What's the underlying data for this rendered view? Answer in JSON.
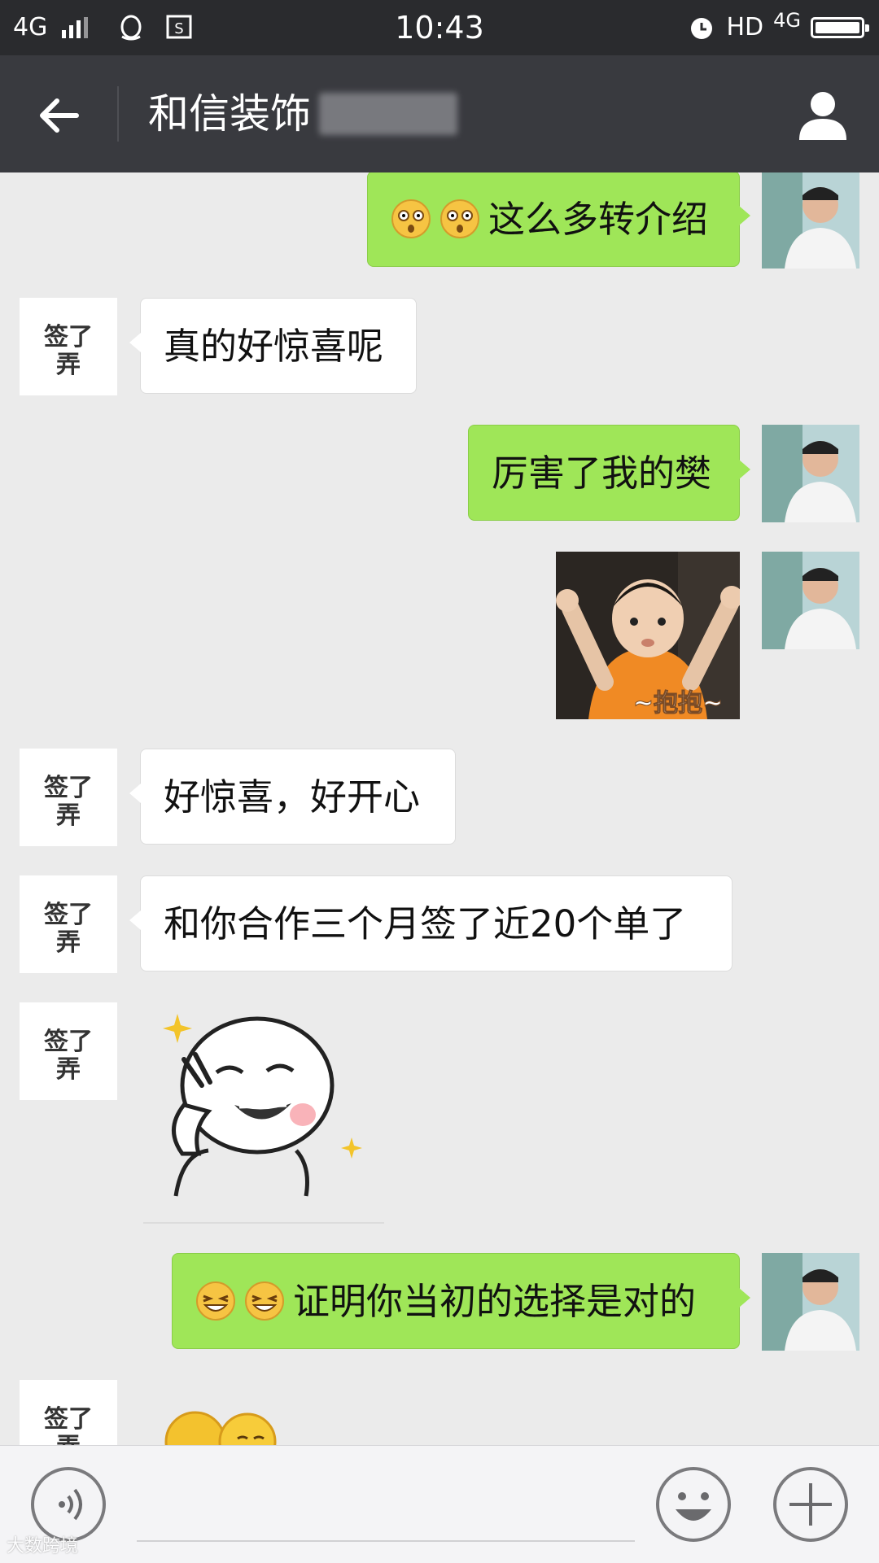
{
  "status_bar": {
    "network_left": "4G",
    "time": "10:43",
    "hd": "HD",
    "network_right": "4G"
  },
  "nav": {
    "title": "和信装饰",
    "back_icon": "arrow-left-icon",
    "profile_icon": "person-icon"
  },
  "messages": [
    {
      "sender": "me",
      "text": "这么多转介绍",
      "emoji": [
        "surprised-emoji",
        "surprised-emoji"
      ]
    },
    {
      "sender": "them",
      "text": "真的好惊喜呢"
    },
    {
      "sender": "me",
      "text": "厉害了我的樊"
    },
    {
      "sender": "me",
      "type": "sticker",
      "caption": "~抱抱~"
    },
    {
      "sender": "them",
      "text": "好惊喜，好开心"
    },
    {
      "sender": "them",
      "text": "和你合作三个月签了近20个单了"
    },
    {
      "sender": "them",
      "type": "sticker",
      "caption": ""
    },
    {
      "sender": "me",
      "text": "证明你当初的选择是对的",
      "emoji": [
        "grin-emoji",
        "grin-emoji"
      ]
    },
    {
      "sender": "them",
      "type": "sticker",
      "caption": ""
    }
  ],
  "avatar_text": {
    "line1": "签了",
    "line2": "弄"
  },
  "input_bar": {
    "voice_icon": "voice-icon",
    "emoji_icon": "smiley-icon",
    "plus_icon": "plus-icon"
  },
  "watermark": "大数跨境",
  "colors": {
    "status_bar": "#2a2b2e",
    "nav_bar": "#393a3f",
    "chat_bg": "#ebebeb",
    "my_bubble": "#9fe658",
    "their_bubble": "#ffffff"
  }
}
